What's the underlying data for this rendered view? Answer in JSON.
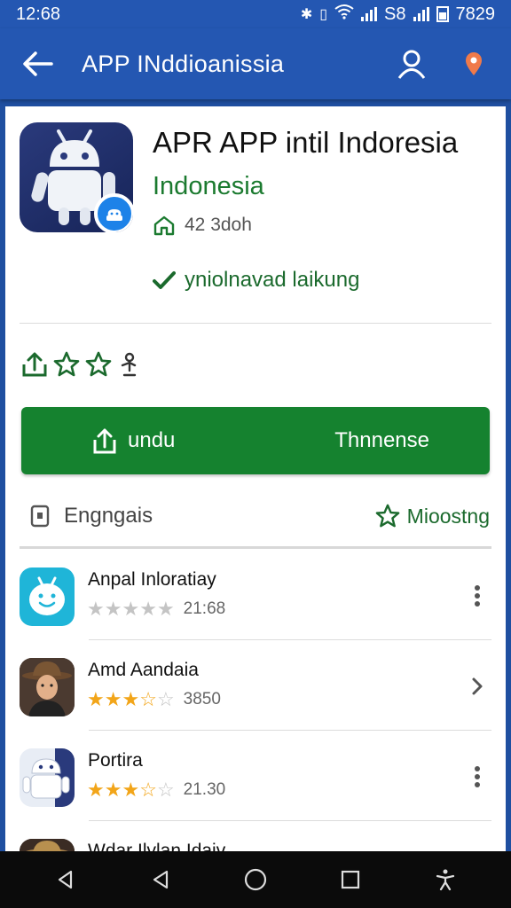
{
  "status_bar": {
    "time": "12:68",
    "carrier": "S8",
    "clock_right": "7829"
  },
  "app_bar": {
    "title": "APP INddioanissia"
  },
  "app": {
    "title": "APR APP intil Indoresia",
    "developer": "Indonesia",
    "downloads": "42 3doh",
    "verified": "yniolnavad laikung"
  },
  "install": {
    "left_label": "undu",
    "right_label": "Thnnense"
  },
  "section": {
    "left_label": "Engngais",
    "right_label": "Mioostng"
  },
  "list": [
    {
      "title": "Anpal Inloratiay",
      "stars_filled": 0,
      "rating": "21:68",
      "action": "more"
    },
    {
      "title": "Amd Aandaia",
      "stars_filled": 3.5,
      "rating": "3850",
      "action": "chevron"
    },
    {
      "title": "Portira",
      "stars_filled": 3.5,
      "rating": "21.30",
      "action": "more"
    },
    {
      "title": "Wdar Ilvlan Idaiv"
    }
  ],
  "colors": {
    "brand_blue": "#2457b2",
    "brand_green": "#15822f",
    "star_gold": "#f2a519",
    "star_empty": "#c4c4c4"
  }
}
